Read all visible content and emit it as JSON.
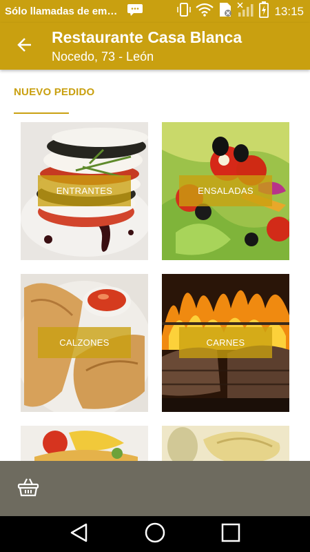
{
  "status_bar": {
    "notification_text": "Sólo llamadas de em…",
    "time": "13:15"
  },
  "app_bar": {
    "title": "Restaurante Casa Blanca",
    "subtitle": "Nocedo, 73 - León"
  },
  "section": {
    "title": "NUEVO PEDIDO"
  },
  "categories": [
    {
      "label": "ENTRANTES"
    },
    {
      "label": "ENSALADAS"
    },
    {
      "label": "CALZONES"
    },
    {
      "label": "CARNES"
    }
  ],
  "colors": {
    "accent": "#c9a010",
    "cart_bar": "#6e6b5f",
    "nav_bar": "#000000"
  },
  "icons": {
    "back": "arrow-left-icon",
    "cart": "basket-icon",
    "nav_back": "triangle-back-icon",
    "nav_home": "circle-home-icon",
    "nav_recents": "square-recents-icon"
  }
}
